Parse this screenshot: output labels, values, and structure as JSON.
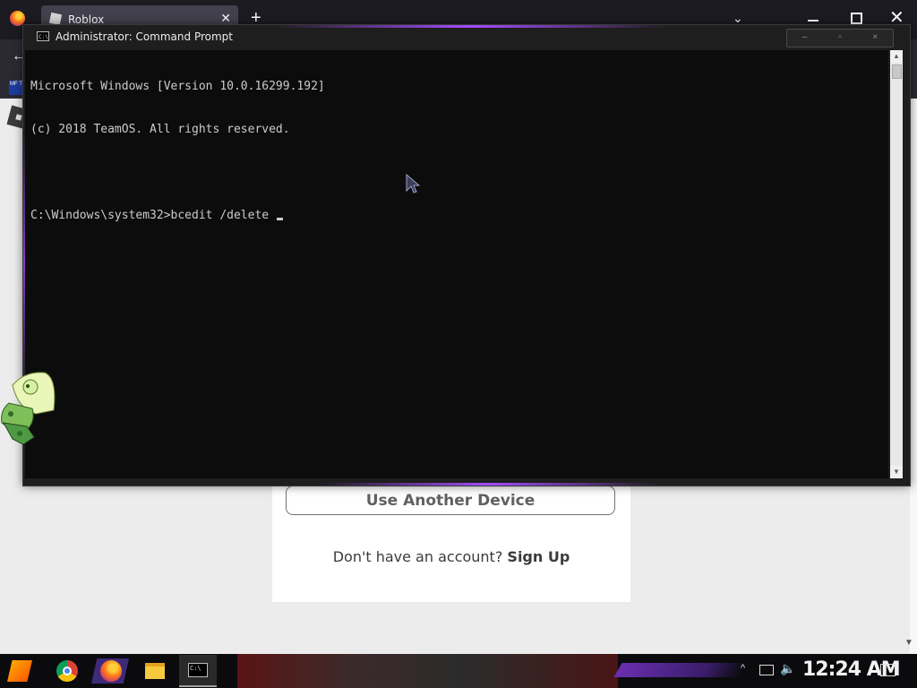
{
  "browser": {
    "tab_title": "Roblox",
    "tab_close": "✕",
    "new_tab": "+",
    "tab_list": "⌄",
    "window_close": "✕",
    "back": "←",
    "extension_badge": "MF T"
  },
  "page": {
    "another_device_label": "Use Another Device",
    "no_account_text": "Don't have an account?",
    "signup_label": "Sign Up"
  },
  "cmd": {
    "title": "Administrator: Command Prompt",
    "icon_text": "C:\\",
    "controls": {
      "minimize": "–",
      "maximize": "▫",
      "close": "×"
    },
    "lines": [
      "Microsoft Windows [Version 10.0.16299.192]",
      "(c) 2018 TeamOS. All rights reserved.",
      "",
      "C:\\Windows\\system32>bcedit /delete "
    ],
    "scroll_up": "▲",
    "scroll_down": "▼"
  },
  "taskbar": {
    "pinned": [
      "start-icon",
      "chrome-icon",
      "firefox-icon",
      "file-explorer-icon",
      "command-prompt-icon"
    ],
    "tray_chevron": "^",
    "volume": "🔈",
    "clock": "12:24 AM"
  },
  "colors": {
    "console_bg": "#0c0c0c",
    "console_text": "#cccccc",
    "accent_purple": "#a44cff",
    "taskbar_bg": "#0b0b0e"
  }
}
